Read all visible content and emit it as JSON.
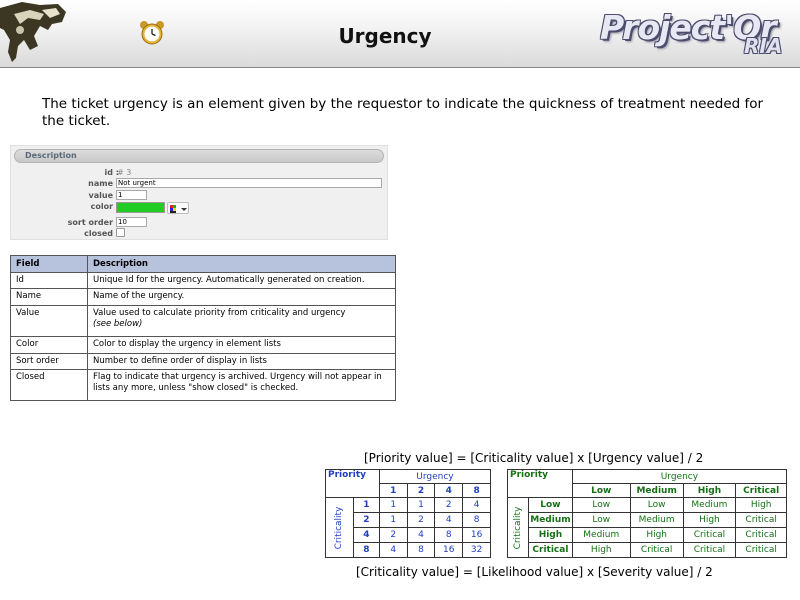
{
  "header": {
    "title": "Urgency",
    "brand_main": "Project'Or",
    "brand_sub": "RIA"
  },
  "intro": "The ticket urgency is an element given by the requestor to indicate the quickness of treatment needed for the ticket.",
  "form": {
    "section_title": "Description",
    "id_label": "id :",
    "id_value": "# 3",
    "name_label": "name :",
    "name_value": "Not urgent",
    "value_label": "value :",
    "value_value": "1",
    "color_label": "color :",
    "color_value": "#22cc22",
    "sort_order_label": "sort order :",
    "sort_order_value": "10",
    "closed_label": "closed :"
  },
  "fields_table": {
    "headers": [
      "Field",
      "Description"
    ],
    "rows": [
      {
        "field": "Id",
        "description": "Unique Id for the urgency. Automatically generated on creation."
      },
      {
        "field": "Name",
        "description": "Name of the urgency."
      },
      {
        "field": "Value",
        "description": "Value used to calculate priority from criticality and urgency",
        "note": "(see below)"
      },
      {
        "field": "Color",
        "description": "Color to display the urgency in element lists"
      },
      {
        "field": "Sort order",
        "description": "Number to define order of display in lists"
      },
      {
        "field": "Closed",
        "description": "Flag to indicate that urgency is archived. Urgency will not appear in lists any more, unless \"show closed\" is checked."
      }
    ]
  },
  "formula_top": "[Priority value] = [Criticality value] x [Urgency value] / 2",
  "formula_bottom": "[Criticality value] = [Likelihood value] x [Severity value] / 2",
  "numeric_matrix": {
    "corner": "Priority",
    "col_group": "Urgency",
    "row_group": "Criticality",
    "cols": [
      "1",
      "2",
      "4",
      "8"
    ],
    "rows": [
      {
        "label": "1",
        "values": [
          "1",
          "1",
          "2",
          "4"
        ]
      },
      {
        "label": "2",
        "values": [
          "1",
          "2",
          "4",
          "8"
        ]
      },
      {
        "label": "4",
        "values": [
          "2",
          "4",
          "8",
          "16"
        ]
      },
      {
        "label": "8",
        "values": [
          "4",
          "8",
          "16",
          "32"
        ]
      }
    ]
  },
  "label_matrix": {
    "corner": "Priority",
    "col_group": "Urgency",
    "row_group": "Criticality",
    "cols": [
      "Low",
      "Medium",
      "High",
      "Critical"
    ],
    "rows": [
      {
        "label": "Low",
        "values": [
          "Low",
          "Low",
          "Medium",
          "High"
        ]
      },
      {
        "label": "Medium",
        "values": [
          "Low",
          "Medium",
          "High",
          "Critical"
        ]
      },
      {
        "label": "High",
        "values": [
          "Medium",
          "High",
          "Critical",
          "Critical"
        ]
      },
      {
        "label": "Critical",
        "values": [
          "High",
          "Critical",
          "Critical",
          "Critical"
        ]
      }
    ]
  },
  "colors": {
    "blue_label": "#1f3fbf",
    "green_label": "#157015",
    "table_header_bg": "#b7c3dd"
  }
}
